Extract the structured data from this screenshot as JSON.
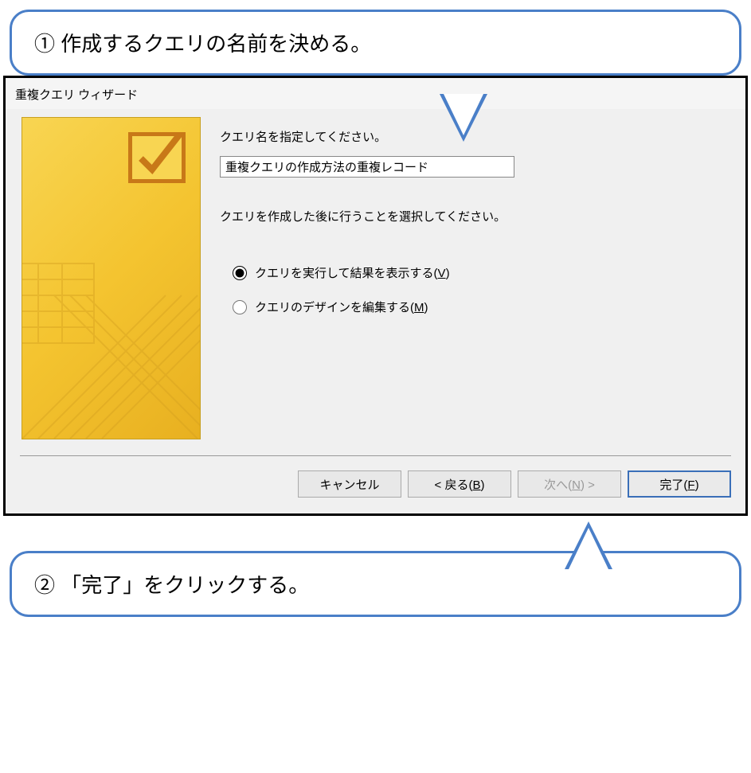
{
  "callouts": {
    "top": "① 作成するクエリの名前を決める。",
    "bottom": "② 「完了」をクリックする。"
  },
  "dialog": {
    "title": "重複クエリ ウィザード",
    "prompt_label": "クエリ名を指定してください。",
    "query_name_value": "重複クエリの作成方法の重複レコード",
    "after_label": "クエリを作成した後に行うことを選択してください。",
    "options": {
      "view": {
        "text": "クエリを実行して結果を表示する(",
        "accel": "V",
        "suffix": ")"
      },
      "modify": {
        "text": "クエリのデザインを編集する(",
        "accel": "M",
        "suffix": ")"
      }
    },
    "buttons": {
      "cancel": "キャンセル",
      "back_prefix": "< 戻る(",
      "back_accel": "B",
      "back_suffix": ")",
      "next_prefix": "次へ(",
      "next_accel": "N",
      "next_suffix": ") >",
      "finish_prefix": "完了(",
      "finish_accel": "F",
      "finish_suffix": ")"
    }
  }
}
